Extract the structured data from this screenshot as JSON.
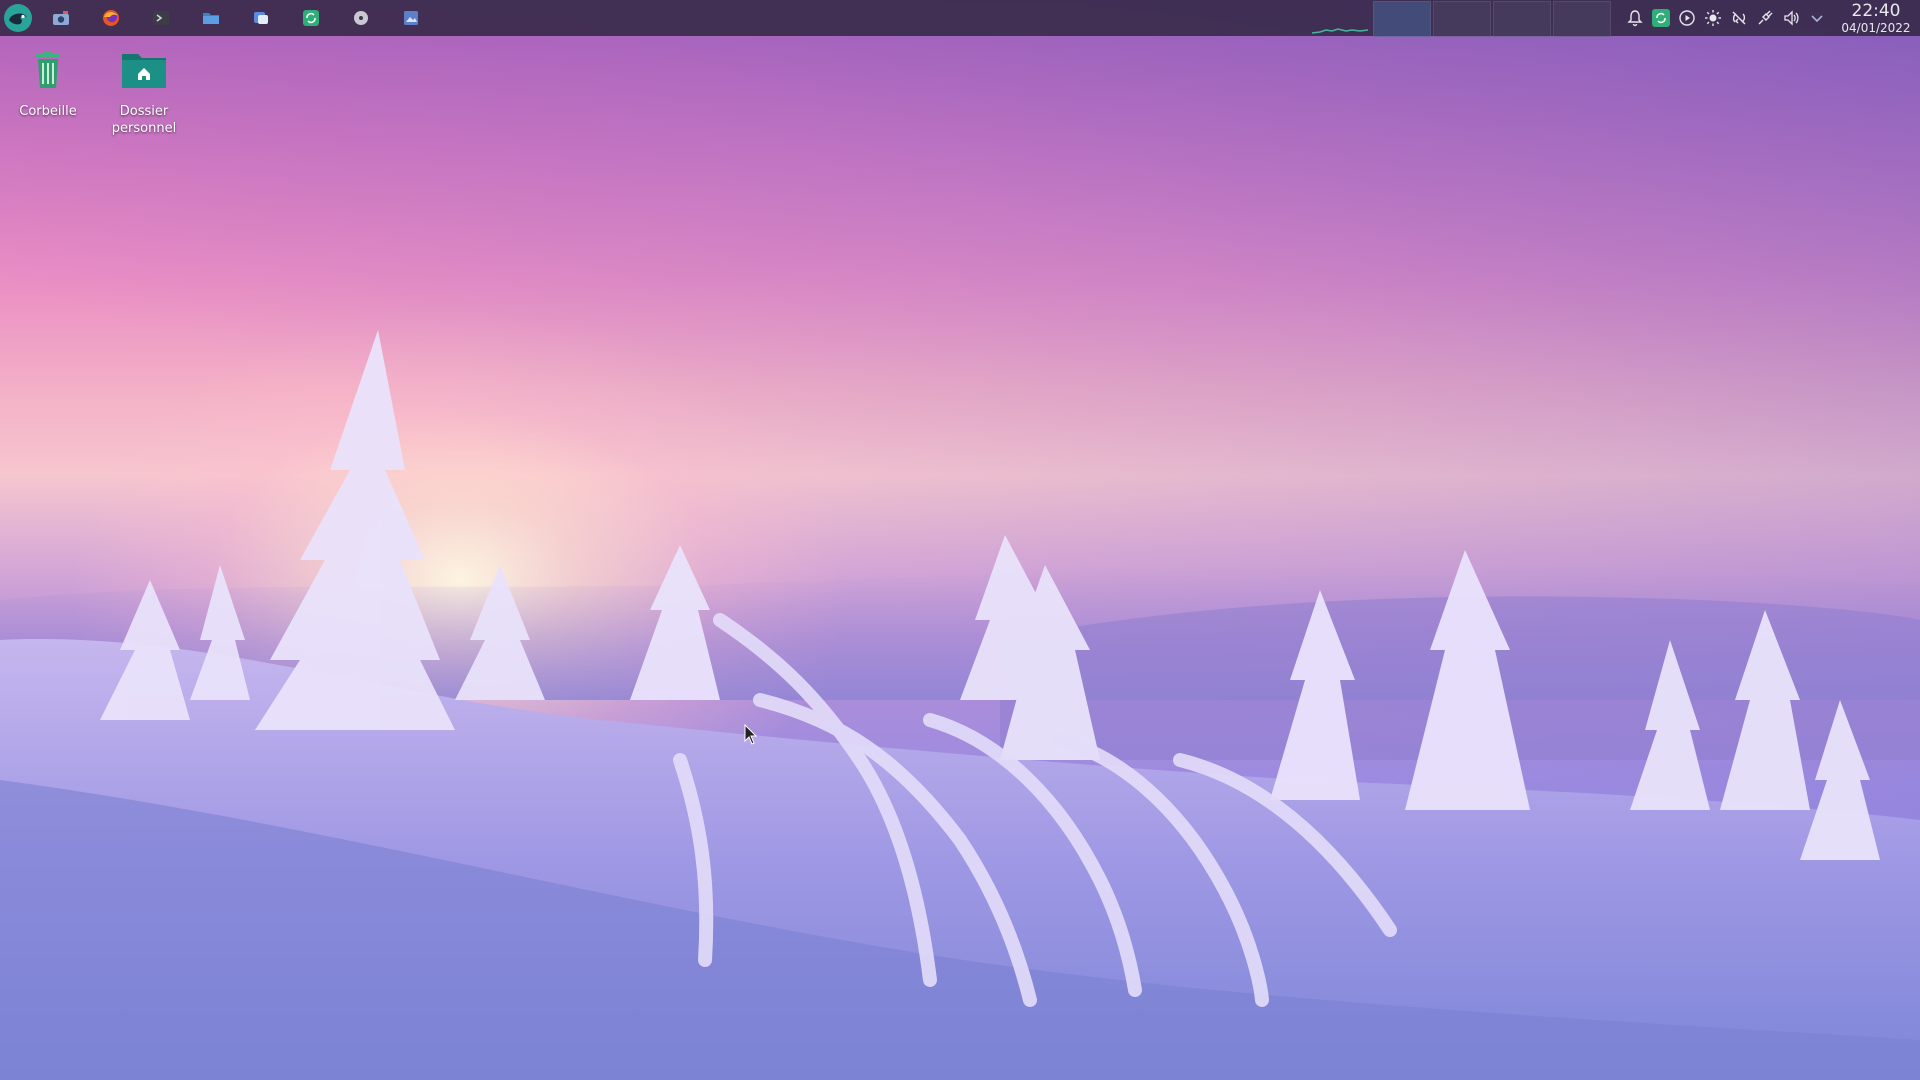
{
  "taskbar": {
    "launcher_icon": "opensuse-gecko-icon",
    "tasks": [
      {
        "name": "camera-app",
        "icon": "camera-icon"
      },
      {
        "name": "firefox",
        "icon": "firefox-icon"
      },
      {
        "name": "terminal",
        "icon": "terminal-icon"
      },
      {
        "name": "file-manager",
        "icon": "folder-icon"
      },
      {
        "name": "discover",
        "icon": "discover-icon"
      },
      {
        "name": "sync-app",
        "icon": "sync-icon"
      },
      {
        "name": "disc-app",
        "icon": "disc-icon"
      },
      {
        "name": "image-viewer",
        "icon": "image-icon"
      }
    ],
    "virtual_desktops": 4,
    "active_desktop": 1
  },
  "tray": {
    "icons": [
      "notification-bell-icon",
      "update-icon",
      "media-play-icon",
      "brightness-icon",
      "network-icon",
      "power-icon",
      "volume-icon",
      "expand-arrow-icon"
    ]
  },
  "clock": {
    "time": "22:40",
    "date": "04/01/2022"
  },
  "desktop_icons": [
    {
      "label": "Corbeille",
      "icon": "trash-icon"
    },
    {
      "label": "Dossier personnel",
      "icon": "home-folder-icon"
    }
  ],
  "colors": {
    "panel": "#342846",
    "accent_green": "#2fae7a",
    "folder_teal": "#1c8f86"
  }
}
